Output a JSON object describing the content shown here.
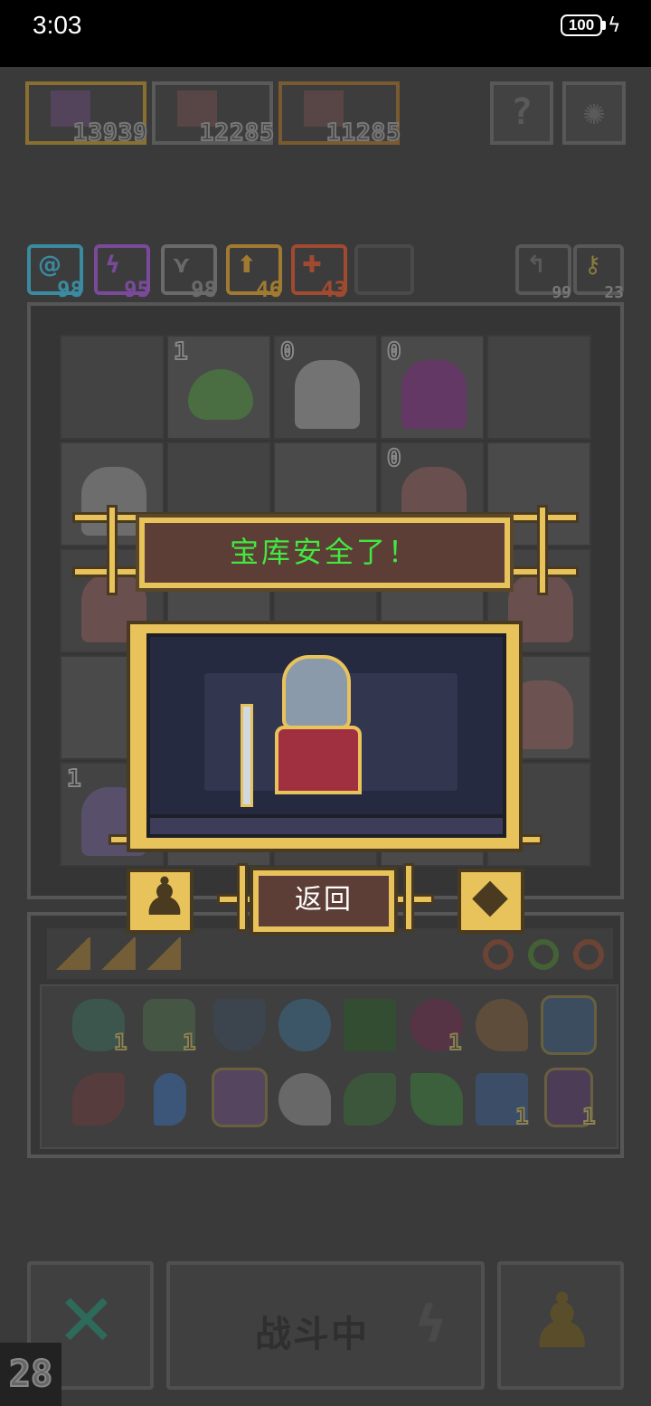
{
  "status": {
    "time": "3:03",
    "battery": "100"
  },
  "scores": [
    {
      "value": "13939",
      "border": "#8a7030",
      "icon_color": "#7a5a8a"
    },
    {
      "value": "12285",
      "border": "#5a5a5a",
      "icon_color": "#8a5a5a"
    },
    {
      "value": "11285",
      "border": "#7a5a30",
      "icon_color": "#8a5a5a"
    }
  ],
  "corner_buttons": {
    "help": "?",
    "settings": "✺"
  },
  "stats": [
    {
      "value": "98",
      "color": "#3a8aa0",
      "glyph": "@"
    },
    {
      "value": "95",
      "color": "#7a4a9a",
      "glyph": "ϟ"
    },
    {
      "value": "98",
      "color": "#6a6a6a",
      "glyph": "⋎"
    },
    {
      "value": "46",
      "color": "#a07a30",
      "glyph": "⬆"
    },
    {
      "value": "43",
      "color": "#a04a30",
      "glyph": "✚"
    }
  ],
  "right_stats": [
    {
      "value": "99"
    },
    {
      "value": "23"
    }
  ],
  "board_cells": [
    {
      "num": "1"
    },
    {
      "num": "0"
    },
    {
      "num": "0"
    },
    {
      "num": "0"
    },
    {
      "num": "1"
    }
  ],
  "dialog": {
    "title": "宝库安全了！",
    "back_label": "返回"
  },
  "inventory_counts": [
    "1",
    "1",
    "1",
    "1",
    "1",
    "1"
  ],
  "controls": {
    "fighting_label": "战斗中",
    "turn": "28"
  }
}
